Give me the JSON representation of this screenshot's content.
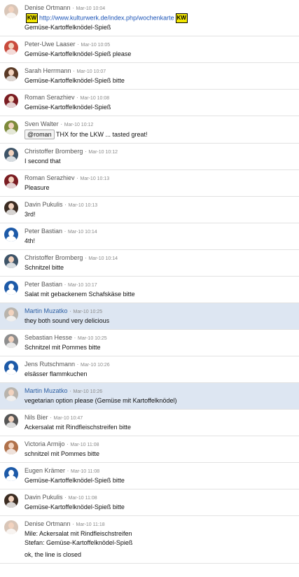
{
  "colors": {
    "highlight": "#dde6f2",
    "accent_name": "#2c5fa3",
    "default_avatar": "#1d5aa8",
    "kw_badge": "#f2e600"
  },
  "messages": [
    {
      "user": "Denise Ortmann",
      "time": "Mar-10 10:04",
      "avatar": "photo",
      "avatar_color": "#d9c6b8",
      "has_link": true,
      "link": "http://www.kulturwerk.de/index.php/wochenkarte",
      "badge": "KW",
      "lines": [
        "Gemüse-Kartoffelknödel-Spieß"
      ]
    },
    {
      "user": "Peter-Uwe Laaser",
      "time": "Mar-10 10:05",
      "avatar": "photo",
      "avatar_color": "#c94a3c",
      "lines": [
        "Gemüse-Kartoffelknödel-Spieß please"
      ]
    },
    {
      "user": "Sarah Herrmann",
      "time": "Mar-10 10:07",
      "avatar": "photo",
      "avatar_color": "#5a3a26",
      "lines": [
        "Gemüse-Kartoffelknödel-Spieß bitte"
      ]
    },
    {
      "user": "Roman Serazhiev",
      "time": "Mar-10 10:08",
      "avatar": "photo",
      "avatar_color": "#7a1c22",
      "lines": [
        "Gemüse-Kartoffelknödel-Spieß"
      ]
    },
    {
      "user": "Sven Walter",
      "time": "Mar-10 10:12",
      "avatar": "photo",
      "avatar_color": "#7d8a3a",
      "mention": "@roman",
      "lines": [
        "THX for the LKW ... tasted great!"
      ]
    },
    {
      "user": "Christoffer Bromberg",
      "time": "Mar-10 10:12",
      "avatar": "photo",
      "avatar_color": "#3e5468",
      "lines": [
        "I second that"
      ]
    },
    {
      "user": "Roman Serazhiev",
      "time": "Mar-10 10:13",
      "avatar": "photo",
      "avatar_color": "#7a1c22",
      "lines": [
        "Pleasure"
      ]
    },
    {
      "user": "Davin Pukulis",
      "time": "Mar-10 10:13",
      "avatar": "photo",
      "avatar_color": "#3b2c22",
      "lines": [
        "3rd!"
      ]
    },
    {
      "user": "Peter Bastian",
      "time": "Mar-10 10:14",
      "avatar": "default",
      "lines": [
        "4th!"
      ]
    },
    {
      "user": "Christoffer Bromberg",
      "time": "Mar-10 10:14",
      "avatar": "photo",
      "avatar_color": "#3e5468",
      "lines": [
        "Schnitzel bitte"
      ]
    },
    {
      "user": "Peter Bastian",
      "time": "Mar-10 10:17",
      "avatar": "default",
      "lines": [
        "Salat mit gebackenem Schafskäse bitte"
      ]
    },
    {
      "user": "Martin Muzatko",
      "time": "Mar-10 10:25",
      "avatar": "photo",
      "avatar_color": "#b9b4ad",
      "highlight": true,
      "lines": [
        "they both sound very delicious"
      ]
    },
    {
      "user": "Sebastian Hesse",
      "time": "Mar-10 10:25",
      "avatar": "photo",
      "avatar_color": "#8e8e8e",
      "lines": [
        "Schnitzel mit Pommes bitte"
      ]
    },
    {
      "user": "Jens Rutschmann",
      "time": "Mar-10 10:26",
      "avatar": "default",
      "lines": [
        "elsässer flammkuchen"
      ]
    },
    {
      "user": "Martin Muzatko",
      "time": "Mar-10 10:26",
      "avatar": "photo",
      "avatar_color": "#b9b4ad",
      "highlight": true,
      "lines": [
        "vegetarian option please (Gemüse mit Kartoffelknödel)"
      ]
    },
    {
      "user": "Nils Bier",
      "time": "Mar-10 10:47",
      "avatar": "photo",
      "avatar_color": "#555555",
      "lines": [
        "Ackersalat mit Rindfleischstreifen bitte"
      ]
    },
    {
      "user": "Victoria Armijo",
      "time": "Mar-10 11:08",
      "avatar": "photo",
      "avatar_color": "#b0714a",
      "lines": [
        "schnitzel mit Pommes bitte"
      ]
    },
    {
      "user": "Eugen Krämer",
      "time": "Mar-10 11:08",
      "avatar": "default",
      "lines": [
        "Gemüse-Kartoffelknödel-Spieß bitte"
      ]
    },
    {
      "user": "Davin Pukulis",
      "time": "Mar-10 11:08",
      "avatar": "photo",
      "avatar_color": "#3b2c22",
      "lines": [
        "Gemüse-Kartoffelknödel-Spieß bitte"
      ]
    },
    {
      "user": "Denise Ortmann",
      "time": "Mar-10 11:18",
      "avatar": "photo",
      "avatar_color": "#d9c6b8",
      "lines": [
        "Mile: Ackersalat mit Rindfleischstreifen",
        "Stefan: Gemüse-Kartoffelknödel-Spieß",
        "",
        "ok, the line is closed"
      ]
    }
  ]
}
